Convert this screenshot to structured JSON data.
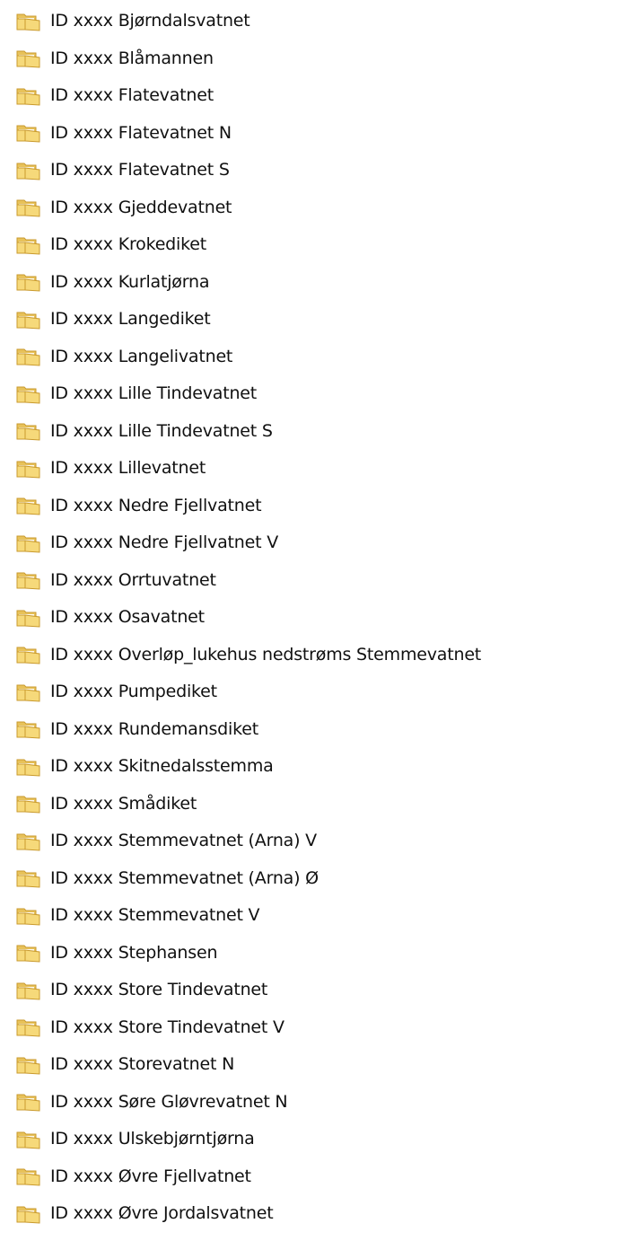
{
  "folders": [
    {
      "name": "ID xxxx Bjørndalsvatnet",
      "icon": "folder-icon"
    },
    {
      "name": "ID xxxx Blåmannen",
      "icon": "folder-icon"
    },
    {
      "name": "ID xxxx Flatevatnet",
      "icon": "folder-icon"
    },
    {
      "name": "ID xxxx Flatevatnet N",
      "icon": "folder-icon"
    },
    {
      "name": "ID xxxx Flatevatnet S",
      "icon": "folder-icon"
    },
    {
      "name": "ID xxxx Gjeddevatnet",
      "icon": "folder-icon"
    },
    {
      "name": "ID xxxx Krokediket",
      "icon": "folder-icon"
    },
    {
      "name": "ID xxxx Kurlatjørna",
      "icon": "folder-icon"
    },
    {
      "name": "ID xxxx Langediket",
      "icon": "folder-icon"
    },
    {
      "name": "ID xxxx Langelivatnet",
      "icon": "folder-icon"
    },
    {
      "name": "ID xxxx Lille Tindevatnet",
      "icon": "folder-icon"
    },
    {
      "name": "ID xxxx Lille Tindevatnet S",
      "icon": "folder-icon"
    },
    {
      "name": "ID xxxx Lillevatnet",
      "icon": "folder-icon"
    },
    {
      "name": "ID xxxx Nedre Fjellvatnet",
      "icon": "folder-icon"
    },
    {
      "name": "ID xxxx Nedre Fjellvatnet V",
      "icon": "folder-icon"
    },
    {
      "name": "ID xxxx Orrtuvatnet",
      "icon": "folder-icon"
    },
    {
      "name": "ID xxxx Osavatnet",
      "icon": "folder-icon"
    },
    {
      "name": "ID xxxx Overløp_lukehus nedstrøms Stemmevatnet",
      "icon": "folder-icon"
    },
    {
      "name": "ID xxxx Pumpediket",
      "icon": "folder-icon"
    },
    {
      "name": "ID xxxx Rundemansdiket",
      "icon": "folder-icon"
    },
    {
      "name": "ID xxxx Skitnedalsstemma",
      "icon": "folder-icon"
    },
    {
      "name": "ID xxxx Smådiket",
      "icon": "folder-icon"
    },
    {
      "name": "ID xxxx Stemmevatnet (Arna) V",
      "icon": "folder-icon"
    },
    {
      "name": "ID xxxx Stemmevatnet (Arna) Ø",
      "icon": "folder-icon"
    },
    {
      "name": "ID xxxx Stemmevatnet V",
      "icon": "folder-icon"
    },
    {
      "name": "ID xxxx Stephansen",
      "icon": "folder-icon"
    },
    {
      "name": "ID xxxx Store Tindevatnet",
      "icon": "folder-icon"
    },
    {
      "name": "ID xxxx Store Tindevatnet V",
      "icon": "folder-icon"
    },
    {
      "name": "ID xxxx Storevatnet N",
      "icon": "folder-icon"
    },
    {
      "name": "ID xxxx Søre Gløvrevatnet N",
      "icon": "folder-icon"
    },
    {
      "name": "ID xxxx Ulskebjørntjørna",
      "icon": "folder-icon"
    },
    {
      "name": "ID xxxx Øvre Fjellvatnet",
      "icon": "folder-icon"
    },
    {
      "name": "ID xxxx Øvre Jordalsvatnet",
      "icon": "folder-icon"
    }
  ],
  "colors": {
    "folder_body": "#e8c25a",
    "folder_front": "#f6d97a",
    "folder_edge": "#c99a2e",
    "text": "#101010",
    "background": "#ffffff"
  }
}
